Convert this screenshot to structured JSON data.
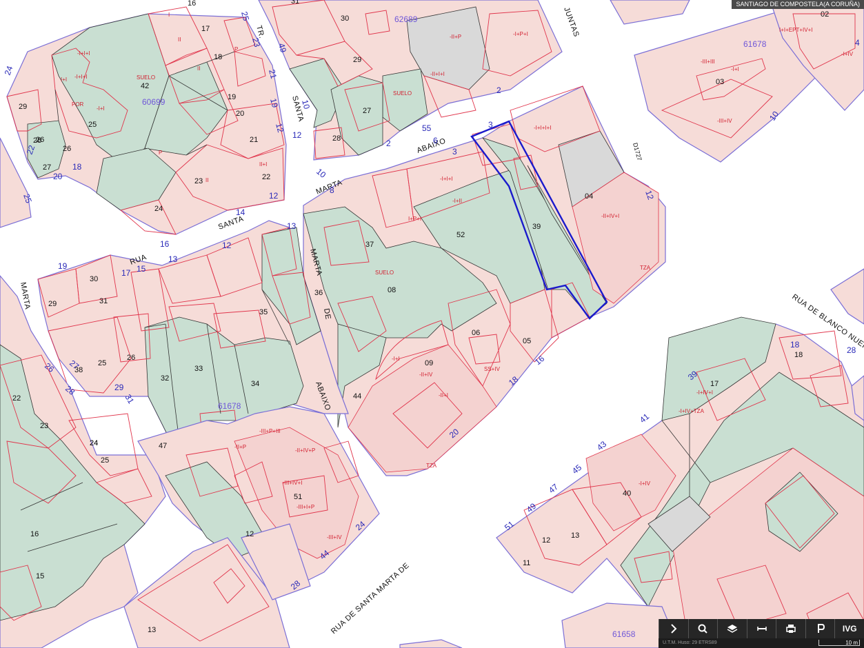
{
  "window": {
    "title": "SANTIAGO DE COMPOSTELA(A CORUÑA)"
  },
  "streets": [
    {
      "key": "santa_marta_abaixo_1",
      "label": "ABAIXO"
    },
    {
      "key": "marta",
      "label": "MARTA"
    },
    {
      "key": "santa",
      "label": "SANTA"
    },
    {
      "key": "rua",
      "label": "RUA"
    },
    {
      "key": "marta_de",
      "label": "MARTA"
    },
    {
      "key": "de",
      "label": "DE"
    },
    {
      "key": "abaixo_2",
      "label": "ABAIXO"
    },
    {
      "key": "rua_de_santa_marta_de",
      "label": "RUA DE SANTA MARTA DE"
    },
    {
      "key": "rua_de_blanco_nuera",
      "label": "RUA DE BLANCO NUERA"
    },
    {
      "key": "santa_vert",
      "label": "SANTA"
    },
    {
      "key": "tr",
      "label": "TR."
    },
    {
      "key": "juntas",
      "label": "JUNTAS"
    },
    {
      "key": "marta_left",
      "label": "MARTA"
    }
  ],
  "block_ids": [
    "62689",
    "61678",
    "60699",
    "61678",
    "61658",
    "D1727"
  ],
  "portal_numbers": [
    "24",
    "22",
    "20",
    "18",
    "25",
    "16",
    "14",
    "12",
    "10",
    "8",
    "6",
    "3",
    "55",
    "2",
    "4",
    "10",
    "12",
    "13",
    "15",
    "17",
    "19",
    "13",
    "12",
    "26",
    "27",
    "28",
    "29",
    "31",
    "18",
    "20",
    "28",
    "44",
    "24",
    "28",
    "16",
    "18",
    "39",
    "41",
    "43",
    "45",
    "47",
    "49",
    "51",
    "12",
    "25",
    "23",
    "49",
    "21",
    "19",
    "10",
    "12",
    "2",
    "3"
  ],
  "parcels": [
    "29",
    "25",
    "26",
    "27",
    "42",
    "17",
    "18",
    "19",
    "20",
    "21",
    "22",
    "23",
    "24",
    "16",
    "30",
    "31",
    "29",
    "28",
    "27",
    "30",
    "37",
    "36",
    "35",
    "33",
    "32",
    "34",
    "31",
    "29",
    "26",
    "25",
    "24",
    "47",
    "51",
    "52",
    "39",
    "04",
    "03",
    "02",
    "08",
    "06",
    "05",
    "09",
    "44",
    "22",
    "23",
    "24",
    "25",
    "16",
    "15",
    "13",
    "12",
    "40",
    "11",
    "12",
    "13",
    "17",
    "18",
    "26",
    "28",
    "38"
  ],
  "floor_labels": [
    "-I+I+I",
    "-I+I+I",
    "I+I",
    "POR",
    "-I+I",
    "II",
    "I",
    "P",
    "SUELO",
    "II",
    "II",
    "P",
    "II+I",
    "-II+P",
    "-I+P+I",
    "-II+I+I",
    "-I+I+I",
    "-I+II",
    "SUELO",
    "SUELO",
    "-I+I",
    "TZA",
    "-II+IV+I",
    "-II+IV",
    "-II+I",
    "SS+IV",
    "-III+P+III",
    "-II+IV+P",
    "-III+IV+I",
    "-III+I+P",
    "-III+IV",
    "-II+P",
    "-I+IV+TZA",
    "-I+IV+I",
    "-I+IV",
    "-III+III",
    "-III+IV",
    "I+I+EPT+IV+I",
    "-I+IV",
    "TZA",
    "-I+I+I+I",
    "-I+I",
    "I+P+I"
  ],
  "toolbar": {
    "buttons": [
      {
        "name": "expand-button",
        "icon": "chevron-right-icon",
        "label": ""
      },
      {
        "name": "search-button",
        "icon": "magnifier-icon",
        "label": ""
      },
      {
        "name": "layers-button",
        "icon": "layers-icon",
        "label": ""
      },
      {
        "name": "measure-button",
        "icon": "measure-icon",
        "label": ""
      },
      {
        "name": "print-button",
        "icon": "printer-icon",
        "label": ""
      },
      {
        "name": "parking-button",
        "icon": "parking-icon",
        "label": ""
      },
      {
        "name": "ivg-button",
        "icon": "",
        "label": "IVG"
      }
    ]
  },
  "footer": {
    "coords": "U.T.M. Huso: 29 ETRS89",
    "scale": "10 m"
  },
  "colors": {
    "background": "#ffffff",
    "building": "#f6dcd8",
    "green": "#c9dfd2",
    "selection": "#1a1acc",
    "portal": "#2a2ab8",
    "block": "#6f57d8",
    "floor": "#d21f2f"
  }
}
